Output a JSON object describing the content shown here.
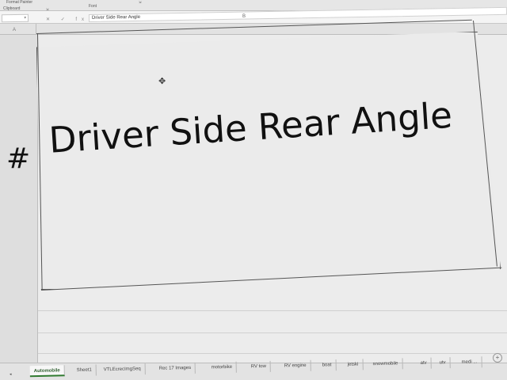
{
  "ribbon": {
    "format_painter": "Format Painter",
    "clipboard": "Clipboard",
    "font": "Font",
    "launcher": "⇲"
  },
  "formula_bar": {
    "name_box": "",
    "content": "Driver Side Rear Angle",
    "icons": "✕ ✓ fx"
  },
  "columns": {
    "A": "A",
    "B": "B"
  },
  "cell": {
    "hash": "#",
    "text": "Driver Side Rear Angle"
  },
  "tabs": [
    {
      "label": "Automobile",
      "active": true
    },
    {
      "label": "Sheet1"
    },
    {
      "label": "VTLEcrecImgSeq"
    },
    {
      "label": "Rec 17 Images"
    },
    {
      "label": "motorbike"
    },
    {
      "label": "RV tow"
    },
    {
      "label": "RV engine"
    },
    {
      "label": "boat"
    },
    {
      "label": "jetski"
    },
    {
      "label": "snowmobile"
    },
    {
      "label": "atv"
    },
    {
      "label": "utv"
    },
    {
      "label": "medi ..."
    }
  ],
  "add_sheet": "+",
  "nav_arrow": "◂"
}
